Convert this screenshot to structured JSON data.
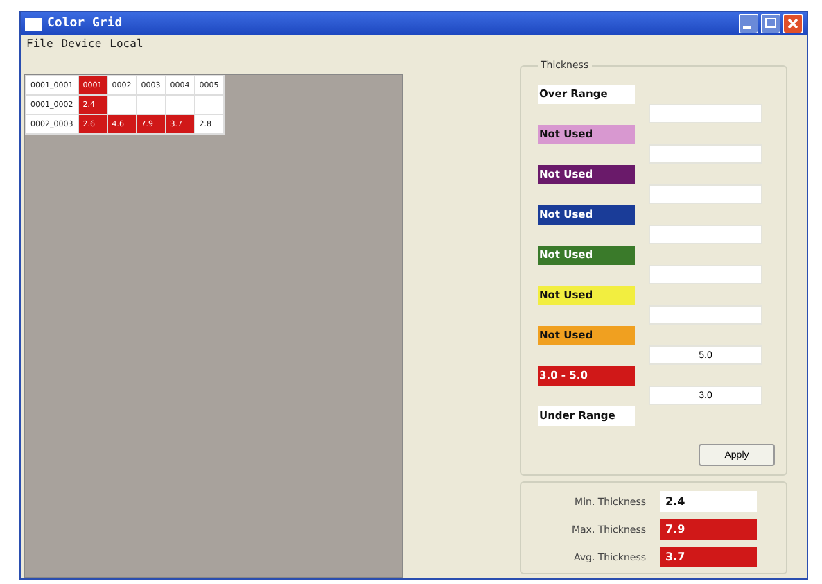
{
  "window": {
    "title": "Color Grid"
  },
  "menu": [
    "File",
    "Device",
    "Local"
  ],
  "grid": {
    "rows": [
      {
        "cells": [
          {
            "text": "0001_0001",
            "color": "#ffffff"
          },
          {
            "text": "0001",
            "color": "#d01818"
          },
          {
            "text": "0002",
            "color": "#ffffff"
          },
          {
            "text": "0003",
            "color": "#ffffff"
          },
          {
            "text": "0004",
            "color": "#ffffff"
          },
          {
            "text": "0005",
            "color": "#ffffff"
          }
        ]
      },
      {
        "cells": [
          {
            "text": "0001_0002",
            "color": "#ffffff"
          },
          {
            "text": "2.4",
            "color": "#d01818"
          },
          {
            "color": "#ffffff"
          },
          {
            "color": "#ffffff"
          },
          {
            "color": "#ffffff"
          },
          {
            "color": "#ffffff"
          }
        ]
      },
      {
        "cells": [
          {
            "text": "0002_0003",
            "color": "#ffffff"
          },
          {
            "text": "2.6",
            "color": "#d01818"
          },
          {
            "text": "4.6",
            "color": "#d01818"
          },
          {
            "text": "7.9",
            "color": "#d01818"
          },
          {
            "text": "3.7",
            "color": "#d01818"
          },
          {
            "text": "2.8",
            "color": "#ffffff"
          }
        ]
      }
    ]
  },
  "thickness": {
    "title": "Thickness",
    "legend": [
      {
        "label": "Over Range",
        "color": "#ffffff"
      },
      {
        "label": "Not Used",
        "color": "#d898d0"
      },
      {
        "label": "Not Used",
        "color": "#6a1a6a"
      },
      {
        "label": "Not Used",
        "color": "#1a3c98"
      },
      {
        "label": "Not Used",
        "color": "#3a7a2a"
      },
      {
        "label": "Not Used",
        "color": "#f2ee40"
      },
      {
        "label": "Not Used",
        "color": "#f0a020"
      },
      {
        "label": "3.0 - 5.0",
        "color": "#d01818"
      },
      {
        "label": "Under Range",
        "color": "#ffffff"
      }
    ],
    "fields": [
      {
        "kind": "blank"
      },
      {
        "kind": "blank"
      },
      {
        "kind": "blank"
      },
      {
        "kind": "blank"
      },
      {
        "kind": "blank"
      },
      {
        "kind": "blank"
      },
      {
        "kind": "filled",
        "value": "5.0"
      },
      {
        "kind": "filled",
        "value": "3.0"
      }
    ],
    "apply_button": "Apply"
  },
  "stats": [
    {
      "label": "Min. Thickness",
      "value": "2.4",
      "color": "#ffffff"
    },
    {
      "label": "Max. Thickness",
      "value": "7.9",
      "color": "#d01818"
    },
    {
      "label": "Avg. Thickness",
      "value": "3.7",
      "color": "#d01818"
    }
  ]
}
